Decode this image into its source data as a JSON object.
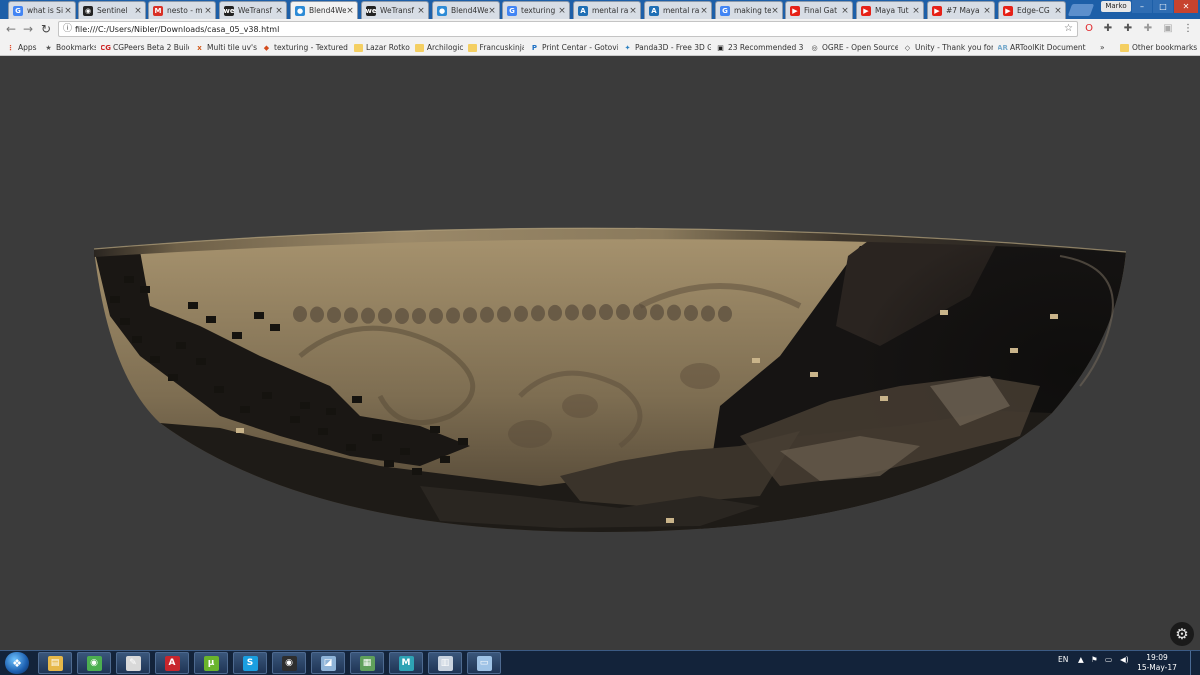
{
  "window": {
    "profile_name": "Marko",
    "minimize_icon": "minimize-icon",
    "maximize_icon": "maximize-icon",
    "close_icon": "close-icon"
  },
  "tabs": [
    {
      "title": "what is Si",
      "icon": "google-icon",
      "color": "#4285f4",
      "glyph": "G"
    },
    {
      "title": "Sentinel",
      "icon": "github-icon",
      "color": "#222222",
      "glyph": "◉"
    },
    {
      "title": "nesto - m",
      "icon": "gmail-icon",
      "color": "#d93025",
      "glyph": "M"
    },
    {
      "title": "WeTransf",
      "icon": "wetransfer-icon",
      "color": "#222222",
      "glyph": "we"
    },
    {
      "title": "Blend4We",
      "icon": "blend4web-icon",
      "color": "#2d8bd6",
      "glyph": "●",
      "active": true
    },
    {
      "title": "WeTransf",
      "icon": "wetransfer-icon",
      "color": "#222222",
      "glyph": "we"
    },
    {
      "title": "Blend4We",
      "icon": "blend4web-icon",
      "color": "#2d8bd6",
      "glyph": "●"
    },
    {
      "title": "texturing",
      "icon": "google-icon",
      "color": "#4285f4",
      "glyph": "G"
    },
    {
      "title": "mental ra",
      "icon": "autodesk-icon",
      "color": "#1f6fb5",
      "glyph": "A"
    },
    {
      "title": "mental ra",
      "icon": "autodesk-icon",
      "color": "#1f6fb5",
      "glyph": "A"
    },
    {
      "title": "making te",
      "icon": "google-icon",
      "color": "#4285f4",
      "glyph": "G"
    },
    {
      "title": "Final Gat",
      "icon": "youtube-icon",
      "color": "#e62117",
      "glyph": "▶"
    },
    {
      "title": "Maya Tut",
      "icon": "youtube-icon",
      "color": "#e62117",
      "glyph": "▶"
    },
    {
      "title": "#7 Maya",
      "icon": "youtube-icon",
      "color": "#e62117",
      "glyph": "▶"
    },
    {
      "title": "Edge-CG",
      "icon": "youtube-icon",
      "color": "#e62117",
      "glyph": "▶"
    }
  ],
  "toolbar": {
    "back_icon": "back-arrow-icon",
    "forward_icon": "forward-arrow-icon",
    "reload_icon": "reload-icon",
    "url": "file:///C:/Users/Nibler/Downloads/casa_05_v38.html",
    "bookmark_star_icon": "star-icon",
    "extensions": [
      "opera-icon",
      "puzzle-icon",
      "puzzle-icon",
      "puzzle-icon",
      "extension-icon",
      "menu-icon"
    ]
  },
  "bookmarks": [
    {
      "label": "Apps",
      "icon": "apps-grid-icon",
      "color": "#e04c2b",
      "glyph": "⋮"
    },
    {
      "label": "Bookmarks",
      "icon": "star-icon",
      "color": "#555555",
      "glyph": "★"
    },
    {
      "label": "CGPeers Beta 2 Build",
      "icon": "cgpeers-icon",
      "color": "#cc2222",
      "glyph": "CG"
    },
    {
      "label": "Multi tile uv's",
      "icon": "multitile-icon",
      "color": "#d15a1c",
      "glyph": "x"
    },
    {
      "label": "texturing - Textured",
      "icon": "pin-icon",
      "color": "#d34a1c",
      "glyph": "◆"
    },
    {
      "label": "Lazar Rotko",
      "icon": "folder-icon",
      "color": "#f4cf62",
      "glyph": ""
    },
    {
      "label": "Archilogic",
      "icon": "folder-icon",
      "color": "#f4cf62",
      "glyph": ""
    },
    {
      "label": "Francuskinja",
      "icon": "folder-icon",
      "color": "#f4cf62",
      "glyph": ""
    },
    {
      "label": "Print Centar - Gotovi",
      "icon": "print-centar-icon",
      "color": "#1b6fc4",
      "glyph": "P"
    },
    {
      "label": "Panda3D - Free 3D G",
      "icon": "panda3d-icon",
      "color": "#2a7fc0",
      "glyph": "✦"
    },
    {
      "label": "23 Recommended 3D",
      "icon": "recommended-3d-icon",
      "color": "#1c1c1c",
      "glyph": "▣"
    },
    {
      "label": "OGRE - Open Source",
      "icon": "ogre-icon",
      "color": "#3a3a3a",
      "glyph": "◎"
    },
    {
      "label": "Unity - Thank you for",
      "icon": "unity-icon",
      "color": "#333333",
      "glyph": "◇"
    },
    {
      "label": "ARToolKit Document",
      "icon": "artoolkit-icon",
      "color": "#7ac",
      "glyph": "AR"
    },
    {
      "label": "Other bookmarks",
      "icon": "folder-icon",
      "color": "#f4cf62",
      "glyph": ""
    }
  ],
  "bookmarks_overflow_icon": "chevron-right-icon",
  "viewport": {
    "background_color": "#3b3b3b",
    "object": "textured-bowl-model",
    "settings_icon": "gear-icon"
  },
  "taskbar": {
    "start_icon": "windows-start-icon",
    "apps": [
      {
        "icon": "file-explorer-icon",
        "color": "#e6b84a",
        "glyph": "▤"
      },
      {
        "icon": "chrome-icon",
        "color": "#4caf50",
        "glyph": "◉"
      },
      {
        "icon": "paint-icon",
        "color": "#d9d9d9",
        "glyph": "✎"
      },
      {
        "icon": "autodesk-icon",
        "color": "#c8262d",
        "glyph": "A"
      },
      {
        "icon": "utorrent-icon",
        "color": "#6ab52c",
        "glyph": "µ"
      },
      {
        "icon": "skype-icon",
        "color": "#1a9fe0",
        "glyph": "S"
      },
      {
        "icon": "nvidia-icon",
        "color": "#2e2e2e",
        "glyph": "◉"
      },
      {
        "icon": "sketch-icon",
        "color": "#8fb4d8",
        "glyph": "◪"
      },
      {
        "icon": "image-viewer-icon",
        "color": "#5fa05b",
        "glyph": "▦"
      },
      {
        "icon": "maya-icon",
        "color": "#2ea3b5",
        "glyph": "M"
      },
      {
        "icon": "calculator-icon",
        "color": "#c9d3df",
        "glyph": "▥"
      },
      {
        "icon": "window-icon",
        "color": "#9fc3e6",
        "glyph": "▭"
      }
    ],
    "language": "EN",
    "tray_icons": [
      "chevron-up-icon",
      "flag-icon",
      "network-icon",
      "volume-icon"
    ],
    "time": "19:09",
    "date": "15-May-17"
  }
}
